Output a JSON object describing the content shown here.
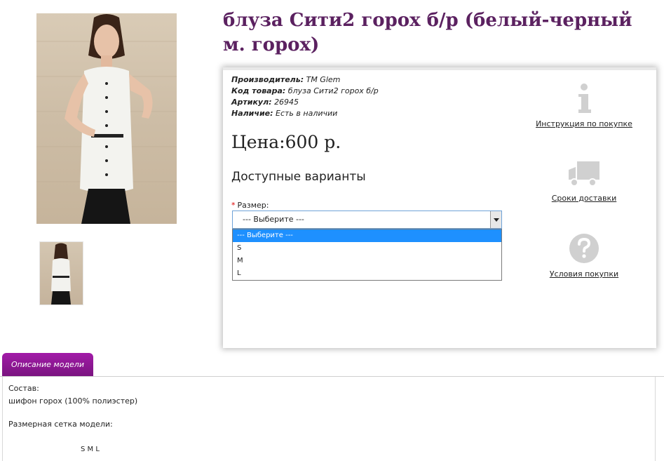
{
  "product": {
    "title": "блуза Сити2 горох б/р (белый-черный м. горох)"
  },
  "meta": {
    "manufacturer_label": "Производитель:",
    "manufacturer_value": "TM Glem",
    "code_label": "Код товара:",
    "code_value": "блуза Сити2 горох б/р",
    "article_label": "Артикул:",
    "article_value": "26945",
    "availability_label": "Наличие:",
    "availability_value": "Есть в наличии"
  },
  "price": "Цена:600 р.",
  "variants": {
    "title": "Доступные варианты",
    "size_required": "*",
    "size_label": "Размер:",
    "selected": "--- Выберите ---",
    "options": [
      "--- Выберите ---",
      "S",
      "M",
      "L"
    ]
  },
  "side_links": {
    "instructions": "Инструкция по покупке",
    "delivery": "Сроки доставки",
    "terms": "Условия покупки"
  },
  "tabs": {
    "description": "Описание модели"
  },
  "description": {
    "composition_label": "Состав:",
    "composition_value": "шифон горох (100% полиэстер)",
    "size_grid_label": "Размерная сетка модели:",
    "sizes_row": "S M L"
  },
  "colors": {
    "title": "#5b2160",
    "tab": "#8e1896",
    "dropdown_highlight": "#1e90ff",
    "icon_gray": "#d0d0d0"
  }
}
